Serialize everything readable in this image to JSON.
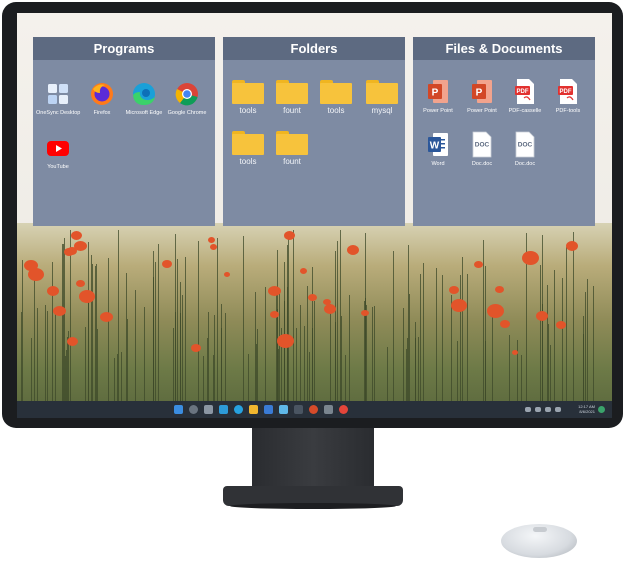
{
  "panels": {
    "programs": {
      "title": "Programs",
      "items": [
        {
          "label": "OneSync Desktop",
          "icon": "windows-apps-icon"
        },
        {
          "label": "Firefox",
          "icon": "firefox-icon"
        },
        {
          "label": "Microsoft Edge",
          "icon": "edge-icon"
        },
        {
          "label": "Google Chrome",
          "icon": "chrome-icon"
        },
        {
          "label": "YouTube",
          "icon": "youtube-icon"
        }
      ]
    },
    "folders": {
      "title": "Folders",
      "items": [
        {
          "label": "tools"
        },
        {
          "label": "fount"
        },
        {
          "label": "tools"
        },
        {
          "label": "mysql"
        },
        {
          "label": "tools"
        },
        {
          "label": "fount"
        }
      ]
    },
    "files": {
      "title": "Files & Documents",
      "items": [
        {
          "label": "Power Point",
          "icon": "powerpoint-icon",
          "badge": "P"
        },
        {
          "label": "Power Point",
          "icon": "powerpoint-icon",
          "badge": "P"
        },
        {
          "label": "PDF-casselle",
          "icon": "pdf-icon",
          "badge": "PDF"
        },
        {
          "label": "PDF-tools",
          "icon": "pdf-icon",
          "badge": "PDF"
        },
        {
          "label": "Word",
          "icon": "word-icon",
          "badge": "W"
        },
        {
          "label": "Doc.doc",
          "icon": "doc-file-icon",
          "badge": "DOC"
        },
        {
          "label": "Doc.doc",
          "icon": "doc-file-icon",
          "badge": "DOC"
        }
      ]
    }
  },
  "taskbar": {
    "time": "12:17 AM",
    "date": "8/6/2021"
  },
  "colors": {
    "panel": "#7e8ba3",
    "panel_header": "#5d6a81",
    "folder": "#f7c33c",
    "powerpoint": "#d24726",
    "pdf": "#e2312f",
    "word": "#2b579a",
    "taskbar": "#28303a"
  }
}
